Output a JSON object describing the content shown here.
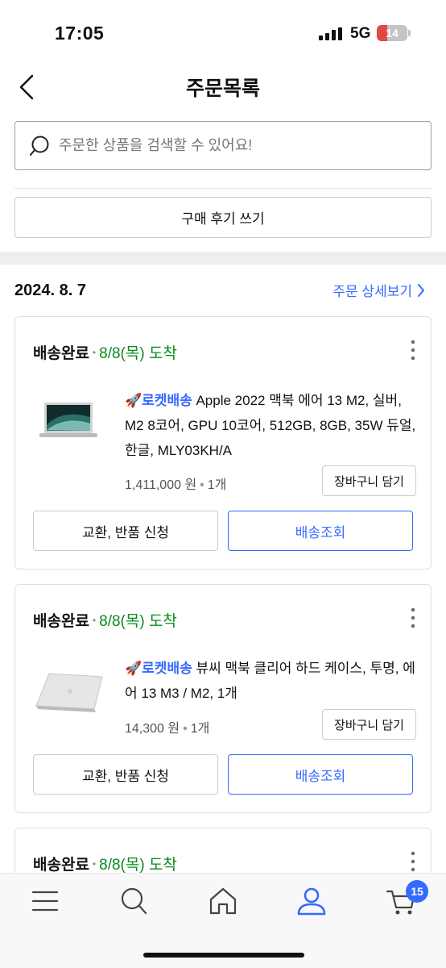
{
  "status_bar": {
    "time": "17:05",
    "network": "5G",
    "battery": "14"
  },
  "header": {
    "title": "주문목록",
    "back_icon": "chevron-left-icon"
  },
  "search": {
    "placeholder": "주문한 상품을 검색할 수 있어요!"
  },
  "review_button": "구매 후기 쓰기",
  "order": {
    "date": "2024. 8. 7",
    "detail_link": "주문 상세보기"
  },
  "items": [
    {
      "status": "배송완료",
      "arrival": "8/8(목) 도착",
      "badge": "🚀로켓배송",
      "name": "Apple 2022 맥북 에어 13 M2, 실버, M2 8코어, GPU 10코어, 512GB, 8GB, 35W 듀얼, 한글, MLY03KH/A",
      "price": "1,411,000 원",
      "quantity": "1개",
      "cart_button": "장바구니 담기",
      "exchange_button": "교환, 반품 신청",
      "track_button": "배송조회"
    },
    {
      "status": "배송완료",
      "arrival": "8/8(목) 도착",
      "badge": "🚀로켓배송",
      "name": "뷰씨 맥북 클리어 하드 케이스, 투명, 에어 13 M3 / M2, 1개",
      "price": "14,300 원",
      "quantity": "1개",
      "cart_button": "장바구니 담기",
      "exchange_button": "교환, 반품 신청",
      "track_button": "배송조회"
    },
    {
      "status": "배송완료",
      "arrival": "8/8(목) 도착"
    }
  ],
  "tabbar": {
    "cart_badge": "15"
  },
  "colors": {
    "accent": "#346aff",
    "arrival_green": "#0a8a1f"
  }
}
